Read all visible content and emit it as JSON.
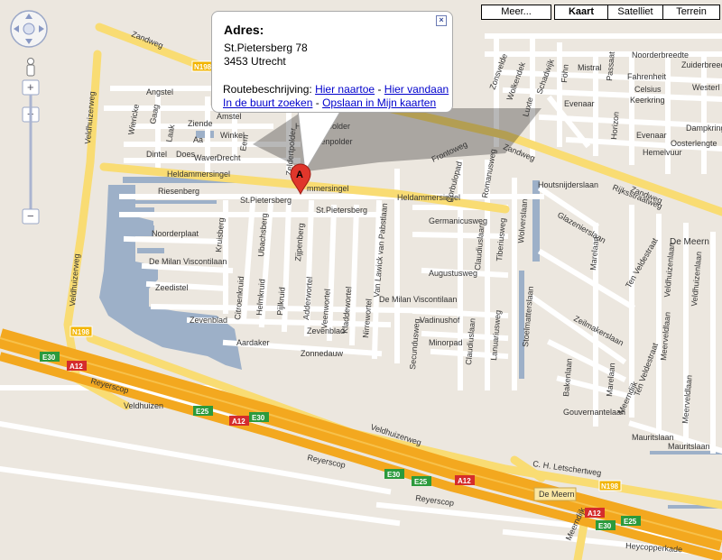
{
  "map": {
    "type_buttons": {
      "more": "Meer...",
      "map": "Kaart",
      "satellite": "Satelliet",
      "terrain": "Terrein",
      "active": "Kaart"
    },
    "infowindow": {
      "title": "Adres:",
      "address_line1": "St.Pietersberg 78",
      "address_line2": "3453 Utrecht",
      "route_label": "Routebeschrijving:",
      "link_to_here": "Hier naartoe",
      "link_from_here": "Hier vandaan",
      "link_nearby": "In de buurt zoeken",
      "link_save": "Opslaan in Mijn kaarten",
      "separator": "-",
      "close_symbol": "×"
    },
    "marker_letter": "A",
    "zoom": {
      "plus": "+",
      "minus": "−"
    },
    "shields": {
      "e30": "E30",
      "e25": "E25",
      "a12": "A12",
      "n198": "N198"
    },
    "colors": {
      "land": "#ece7df",
      "street": "#ffffff",
      "major_road": "#f9dc73",
      "highway": "#f3a81f",
      "water": "#9db0c8",
      "link": "#0000cc",
      "marker": "#e0362b"
    },
    "labels": {
      "zandweg": "Zandweg",
      "veldhuizerweg_v1": "Veldhuizerweg",
      "veldhuizerweg_v2": "Veldhuizerweg",
      "veldhuizerweg_h": "Veldhuizerweg",
      "angstel": "Angstel",
      "gaag": "Gaag",
      "wiericke": "Wiericke",
      "laak": "Laak",
      "ziende": "Ziende",
      "amstel": "Amstel",
      "winkel": "Winkel",
      "aa": "Aa",
      "drecht": "Drecht",
      "dintel": "Dintel",
      "does": "Does",
      "waver": "Waver",
      "eem": "Eem",
      "honswijkpolder": "Honswijkpolder",
      "bovenpolder": "Bovenpolder",
      "zeldertpolder": "Zeldertpolder",
      "heldammersingel": "Heldammersingel",
      "heldammersingel2": "Heldammersingel",
      "heldammersingel3": "mmersingel",
      "riesenberg": "Riesenberg",
      "stpietersberg": "St.Pietersberg",
      "stpietersberg2": "St.Pietersberg",
      "kruisberg": "Kruisberg",
      "ubachsberg": "Ubachsberg",
      "zijpenberg": "Zijpenberg",
      "noorderplaat": "Noorderplaat",
      "demilan": "De Milan Viscontilaan",
      "demilan2": "De Milan Viscontilaan",
      "zeedistel": "Zeedistel",
      "citroenkruid": "Citroenkruid",
      "helmkruid": "Helmkruid",
      "pijlkruid": "Pijlkruid",
      "adderwortel": "Adderwortel",
      "veenwortel": "Veenwortel",
      "kladdewortel": "Kladdewortel",
      "nirrewortel": "Nirrewortel",
      "zevenblad": "Zevenblad",
      "zevenblad2": "Zevenblad",
      "aardaker": "Aardaker",
      "zonnedauw": "Zonnedauw",
      "vanlawick": "Van Lawick van Pabstlaan",
      "frontoweg": "Frontoweg",
      "corbulopad": "Corbulopad",
      "romanusweg": "Romanusweg",
      "germanicusweg": "Germanicusweg",
      "claudiuslaan": "Claudiuslaan",
      "tiberiusweg": "Tiberiusweg",
      "augustusweg": "Augustusweg",
      "vadinushof": "Vadinushof",
      "minorpad": "Minorpad",
      "secundusweg": "Secundusweg",
      "claudiuslaan2": "Claudiuslaan",
      "lanuariusweg": "Lanuariusweg",
      "houtsnijderslaan": "Houtsnijderslaan",
      "glazeniersiaan": "Glazenierslaan",
      "wolversiaan": "Wolverslaan",
      "stoelmatersiaan": "Stoelmatterslaan",
      "zeilmakerslaan": "Zeilmakerslaan",
      "bakenlaan": "Bakenlaan",
      "gouvernantelaan": "Gouvernantelaan",
      "meerndijk": "Meerndijk",
      "meerndijk2": "Meerndijk",
      "marelaan": "Marelaan",
      "marelaan2": "Marelaan",
      "tenveldestraat": "Ten Veldestraat",
      "tenveldestraat2": "Ten Veldestraat",
      "veldhuizenlaan": "Veldhuizenlaan",
      "veldhuizenlaan2": "Veldhuizenlaan",
      "meerveldlaan": "Meerveldlaan",
      "meerveldlaan2": "Meerveldlaan",
      "mauritslaan": "Mauritslaan",
      "mauritslaan2": "Mauritslaan",
      "rijksstraatweg": "Rijksstraatweg",
      "zonsvelde": "Zonsvelde",
      "wolkendek": "Wolkendek",
      "luxte": "Luxte",
      "schadwijk": "Schadwijk",
      "fohn": "Föhn",
      "mistral": "Mistral",
      "passaat": "Passaat",
      "fahrenheit": "Fahrenheit",
      "celsius": "Celsius",
      "keerkring": "Keerkring",
      "evenaar": "Evenaar",
      "evenaar2": "Evenaar",
      "noorderbreedte": "Noorderbreedte",
      "zuiderbreedte": "Zuiderbreedte",
      "westerl": "Westerl",
      "horizon": "Horizon",
      "dampkring": "Dampkring",
      "oosterlengte": "Oosterlengte",
      "hemelvuur": "Hemelvuur",
      "zandweg2": "Zandweg",
      "zandweg3": "Zandweg",
      "demeern": "De Meern",
      "demeern_town": "De Meern",
      "veldhuizen": "Veldhuizen",
      "reyerscop": "Reyerscop",
      "reyerscop2": "Reyerscop",
      "reyerscop3": "Reyerscop",
      "letschertweg": "C. H. Letschertweg",
      "heycopperkade": "Heycopperkade"
    }
  }
}
